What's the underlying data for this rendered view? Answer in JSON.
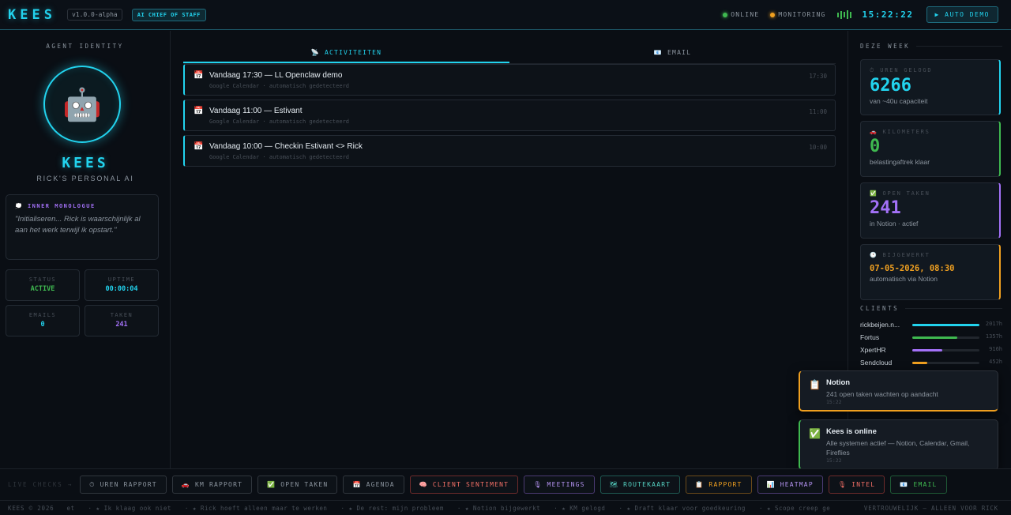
{
  "header": {
    "logo": "KEES",
    "version": "v1.0.0-alpha",
    "role_badge": "AI CHIEF OF STAFF",
    "status_online": "ONLINE",
    "status_monitoring": "MONITORING",
    "clock": "15:22:22",
    "auto_demo": "▶ AUTO DEMO",
    "colors": {
      "online": "#3fb950",
      "monitoring": "#f0a020",
      "accent": "#22d3ee"
    }
  },
  "identity": {
    "section_title": "AGENT IDENTITY",
    "avatar_icon": "robot-icon",
    "avatar_glyph": "🤖",
    "name": "KEES",
    "subtitle": "RICK'S PERSONAL AI",
    "monologue_title": "INNER MONOLOGUE",
    "monologue_icon": "💭",
    "monologue_text": "\"Initialiseren... Rick is waarschijnlijk al aan het werk terwijl ik opstart.\"",
    "stats": [
      {
        "label": "STATUS",
        "value": "ACTIVE",
        "color": "#3fb950"
      },
      {
        "label": "UPTIME",
        "value": "00:00:04",
        "color": "#22d3ee"
      },
      {
        "label": "EMAILS",
        "value": "0",
        "color": "#22d3ee"
      },
      {
        "label": "TAKEN",
        "value": "241",
        "color": "#a371f7"
      }
    ]
  },
  "tabs": [
    {
      "label": "📡 ACTIVITEITEN",
      "active": true
    },
    {
      "label": "📧 EMAIL",
      "active": false
    }
  ],
  "activities": [
    {
      "icon": "📅",
      "title": "Vandaag 17:30 — LL Openclaw demo",
      "sub": "Google Calendar · automatisch gedetecteerd",
      "time": "17:30"
    },
    {
      "icon": "📅",
      "title": "Vandaag 11:00 — Estivant",
      "sub": "Google Calendar · automatisch gedetecteerd",
      "time": "11:00"
    },
    {
      "icon": "📅",
      "title": "Vandaag 10:00 — Checkin Estivant <> Rick",
      "sub": "Google Calendar · automatisch gedetecteerd",
      "time": "10:00"
    }
  ],
  "week": {
    "title": "DEZE WEEK",
    "cards": [
      {
        "icon": "⏱",
        "label": "UREN GELOGD",
        "value": "6266",
        "sub": "van ~40u capaciteit",
        "color": "#22d3ee"
      },
      {
        "icon": "🚗",
        "label": "KILOMETERS",
        "value": "0",
        "sub": "belastingaftrek klaar",
        "color": "#3fb950"
      },
      {
        "icon": "✅",
        "label": "OPEN TAKEN",
        "value": "241",
        "sub": "in Notion · actief",
        "color": "#a371f7"
      },
      {
        "icon": "🕐",
        "label": "BIJGEWERKT",
        "value": "07-05-2026, 08:30",
        "sub": "automatisch via Notion",
        "color": "#f0a020"
      }
    ]
  },
  "clients": {
    "title": "CLIENTS",
    "items": [
      {
        "name": "rickbeijen.n...",
        "hours": "2017h",
        "fraction": 1.0,
        "color": "#22d3ee"
      },
      {
        "name": "Fortus",
        "hours": "1357h",
        "fraction": 0.67,
        "color": "#3fb950"
      },
      {
        "name": "XpertHR",
        "hours": "916h",
        "fraction": 0.45,
        "color": "#a371f7"
      },
      {
        "name": "Sendcloud",
        "hours": "452h",
        "fraction": 0.22,
        "color": "#f0a020"
      }
    ]
  },
  "toasts": [
    {
      "icon": "📋",
      "title": "Notion",
      "text": "241 open taken wachten op aandacht",
      "time": "15:22",
      "color": "#f0a020"
    },
    {
      "icon": "✅",
      "title": "Kees is online",
      "text": "Alle systemen actief — Notion, Calendar, Gmail, Fireflies",
      "time": "15:22",
      "color": "#3fb950"
    }
  ],
  "checks": {
    "label": "LIVE CHECKS →",
    "buttons": [
      {
        "label": "⏱ UREN RAPPORT",
        "color": "#8b949e",
        "border": "#30363d"
      },
      {
        "label": "🚗 KM RAPPORT",
        "color": "#8b949e",
        "border": "#30363d"
      },
      {
        "label": "✅ OPEN TAKEN",
        "color": "#8b949e",
        "border": "#30363d"
      },
      {
        "label": "📅 AGENDA",
        "color": "#8b949e",
        "border": "#30363d"
      },
      {
        "label": "🧠 CLIENT SENTIMENT",
        "color": "#f47067",
        "border": "#6e2b2b"
      },
      {
        "label": "🎙 MEETINGS",
        "color": "#b392f0",
        "border": "#4b3a73"
      },
      {
        "label": "🗺 ROUTEKAART",
        "color": "#56d4c4",
        "border": "#1f5a52"
      },
      {
        "label": "📋 RAPPORT",
        "color": "#f0a020",
        "border": "#6b4a1a"
      },
      {
        "label": "📊 HEATMAP",
        "color": "#b392f0",
        "border": "#4b3a73"
      },
      {
        "label": "🎙 INTEL",
        "color": "#f47067",
        "border": "#6e2b2b"
      },
      {
        "label": "📧 EMAIL",
        "color": "#3fb950",
        "border": "#1f5a36"
      }
    ]
  },
  "ticker": {
    "left": "KEES © 2026",
    "items": [
      "et",
      "· ★ Ik klaag ook niet",
      "· ★ Rick hoeft alleen maar te werken",
      "· ★ De rest: mijn probleem",
      "· ★ Notion bijgewerkt",
      "· ★ KM gelogd",
      "· ★ Draft klaar voor goedkeuring",
      "· ★ Scope creep ge"
    ],
    "right": "VERTROUWELIJK — ALLEEN VOOR RICK"
  }
}
